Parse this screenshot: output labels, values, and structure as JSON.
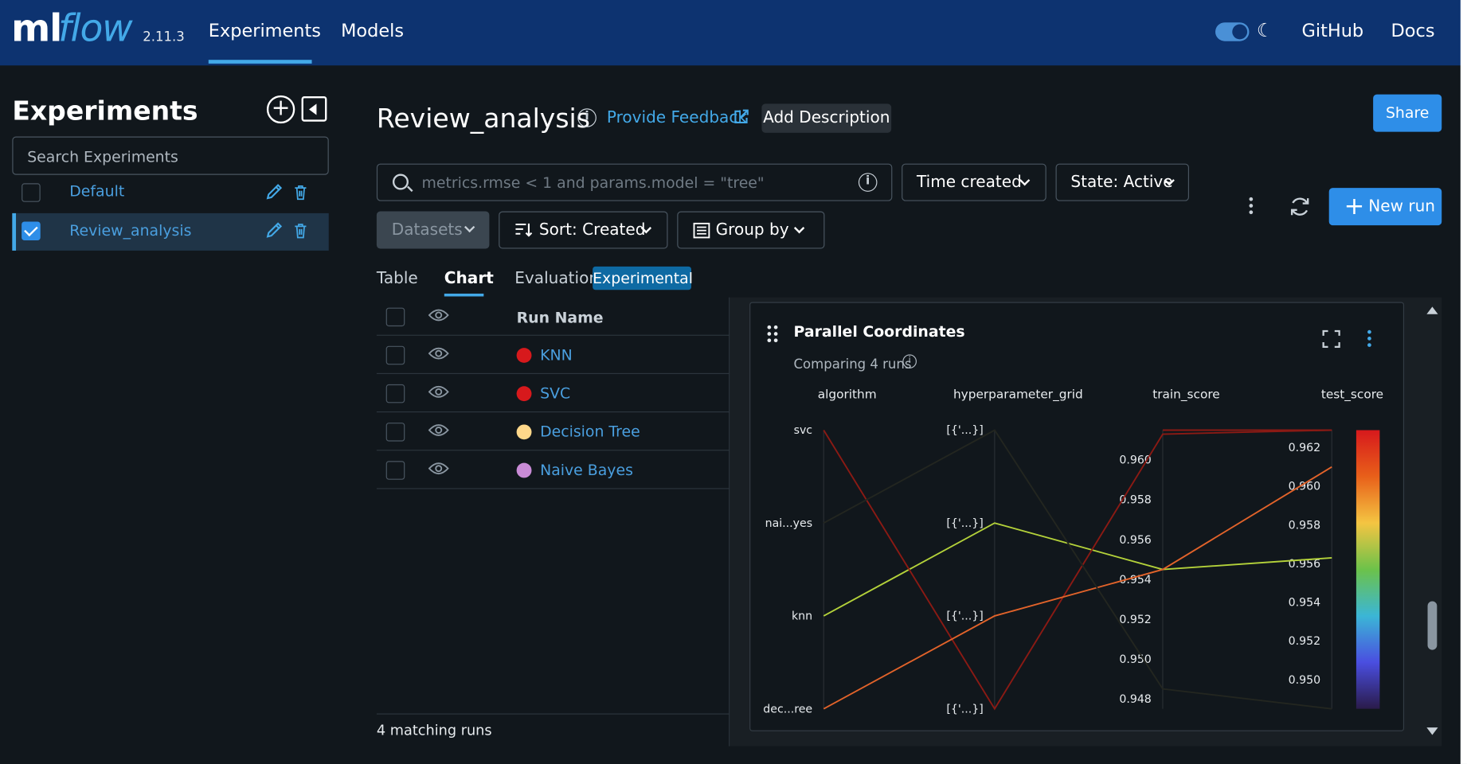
{
  "app": {
    "logo_ml": "ml",
    "logo_flow": "flow",
    "version": "2.11.3",
    "nav": [
      {
        "label": "Experiments",
        "active": true
      },
      {
        "label": "Models",
        "active": false
      }
    ],
    "links": [
      {
        "label": "GitHub"
      },
      {
        "label": "Docs"
      }
    ],
    "theme_toggle": "dark"
  },
  "sidebar": {
    "title": "Experiments",
    "search_placeholder": "Search Experiments",
    "items": [
      {
        "label": "Default",
        "checked": false
      },
      {
        "label": "Review_analysis",
        "checked": true
      }
    ]
  },
  "header": {
    "title": "Review_analysis",
    "feedback_label": "Provide Feedback",
    "add_description_label": "Add Description",
    "share_label": "Share"
  },
  "toolbar": {
    "search_placeholder": "metrics.rmse < 1 and params.model = \"tree\"",
    "time_label": "Time created",
    "state_label": "State: Active",
    "datasets_label": "Datasets",
    "sort_label": "Sort: Created",
    "group_label": "Group by",
    "new_run_label": "New run"
  },
  "view_tabs": [
    {
      "label": "Table",
      "active": false
    },
    {
      "label": "Chart",
      "active": true
    },
    {
      "label": "Evaluation",
      "active": false
    }
  ],
  "experimental_badge": "Experimental",
  "runs_table": {
    "header": "Run Name",
    "rows": [
      {
        "name": "KNN",
        "color": "#d7191c"
      },
      {
        "name": "SVC",
        "color": "#d7191c"
      },
      {
        "name": "Decision Tree",
        "color": "#ffd88a"
      },
      {
        "name": "Naive Bayes",
        "color": "#c98bd6"
      }
    ],
    "footer": "4 matching runs"
  },
  "chart_card": {
    "title": "Parallel Coordinates",
    "subtitle": "Comparing 4 runs"
  },
  "chart_data": {
    "type": "parallel_coordinates",
    "dimensions": [
      {
        "name": "algorithm",
        "kind": "categorical",
        "ticks": [
          "svc",
          "nai...yes",
          "knn",
          "dec...ree"
        ]
      },
      {
        "name": "hyperparameter_grid",
        "kind": "categorical",
        "ticks": [
          "[{'...}]",
          "[{'...}]",
          "[{'...}]",
          "[{'...}]"
        ]
      },
      {
        "name": "train_score",
        "kind": "numeric",
        "ticks": [
          0.96,
          0.958,
          0.956,
          0.954,
          0.952,
          0.95,
          0.948
        ],
        "tick_labels": [
          "0.960",
          "0.958",
          "0.956",
          "0.954",
          "0.952",
          "0.950",
          "0.948"
        ],
        "range": [
          0.9475,
          0.9615
        ]
      },
      {
        "name": "test_score",
        "kind": "numeric",
        "ticks": [
          0.962,
          0.96,
          0.958,
          0.956,
          0.954,
          0.952,
          0.95
        ],
        "tick_labels": [
          "0.962",
          "0.960",
          "0.958",
          "0.956",
          "0.954",
          "0.952",
          "0.950"
        ],
        "range": [
          0.9485,
          0.9629
        ]
      }
    ],
    "colorscale": [
      "#d7191c",
      "#e8601a",
      "#f4c542",
      "#6cc24a",
      "#3bb6d6",
      "#4a4ee0",
      "#2a1b4a"
    ],
    "lines": [
      {
        "run": "KNN",
        "algorithm": "knn",
        "hyperparameter_grid_index": 1,
        "train_score": 0.9545,
        "test_score": 0.9563,
        "color": "#b4d23a"
      },
      {
        "run": "SVC",
        "algorithm": "svc",
        "hyperparameter_grid_index": 3,
        "train_score": 0.9613,
        "test_score": 0.9629,
        "color": "#8b1a14"
      },
      {
        "run": "Decision Tree",
        "algorithm": "dec...ree",
        "hyperparameter_grid_index": 2,
        "train_score": 0.9545,
        "test_score": 0.961,
        "color": "#e2632a"
      },
      {
        "run": "Naive Bayes",
        "algorithm": "nai...yes",
        "hyperparameter_grid_index": 0,
        "train_score": 0.9485,
        "test_score": 0.9485,
        "color": "#232620"
      }
    ]
  }
}
